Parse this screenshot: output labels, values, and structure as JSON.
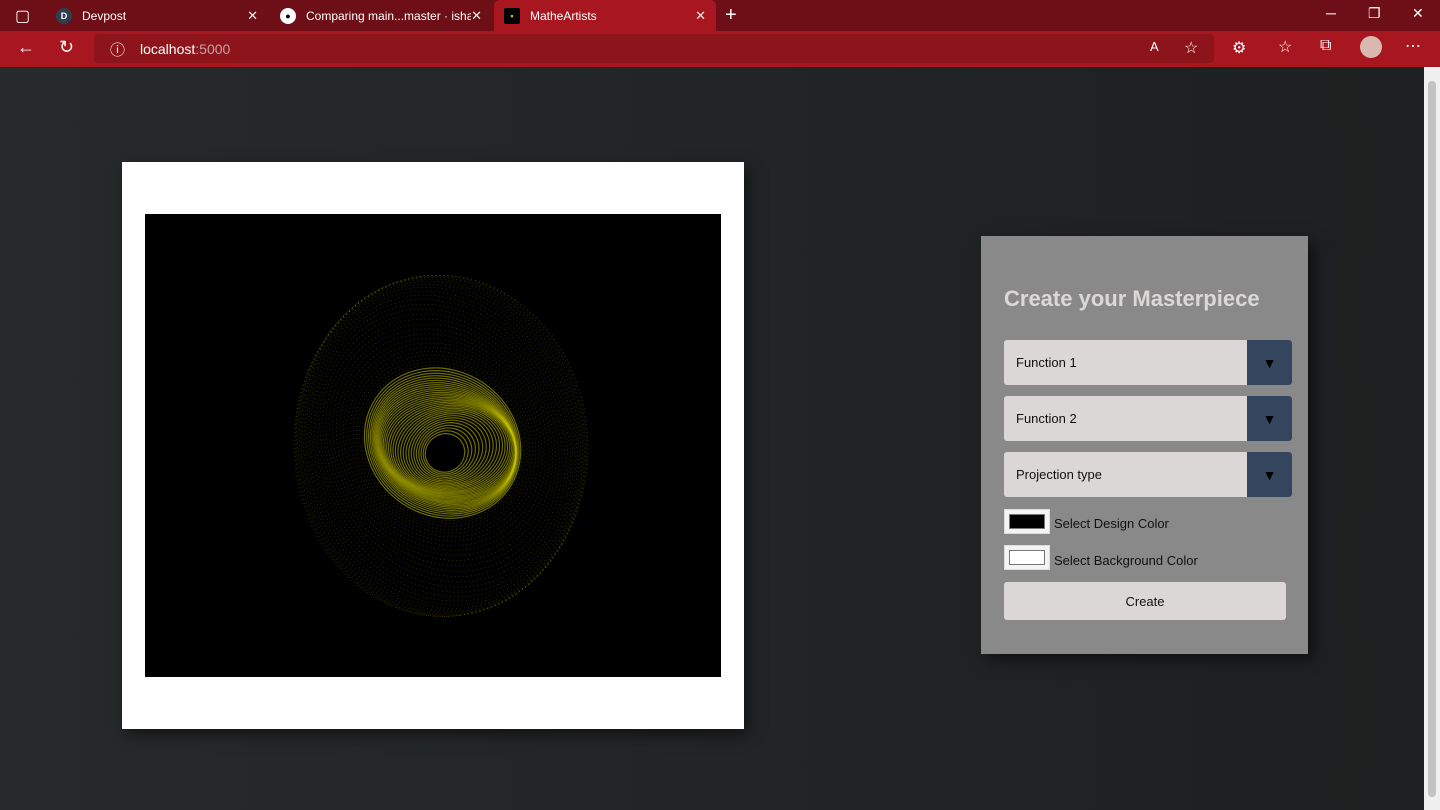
{
  "browser": {
    "tabs": [
      {
        "title": "Devpost",
        "favicon": "D"
      },
      {
        "title": "Comparing main...master · ishan",
        "favicon": "github-icon"
      },
      {
        "title": "MatheArtists",
        "favicon": "matheartists-icon"
      }
    ],
    "url_host": "localhost",
    "url_port": ":5000"
  },
  "colors": {
    "accent": "#a8171f",
    "art": "#c8c400",
    "dropdown_arrow_bg": "#34465d"
  },
  "panel": {
    "title": "Create your Masterpiece",
    "selects": [
      {
        "label": "Function 1"
      },
      {
        "label": "Function 2"
      },
      {
        "label": "Projection type"
      }
    ],
    "design_color_label": "Select Design Color",
    "design_color": "#000000",
    "background_color_label": "Select Background Color",
    "background_color": "#ffffff",
    "create_label": "Create"
  }
}
